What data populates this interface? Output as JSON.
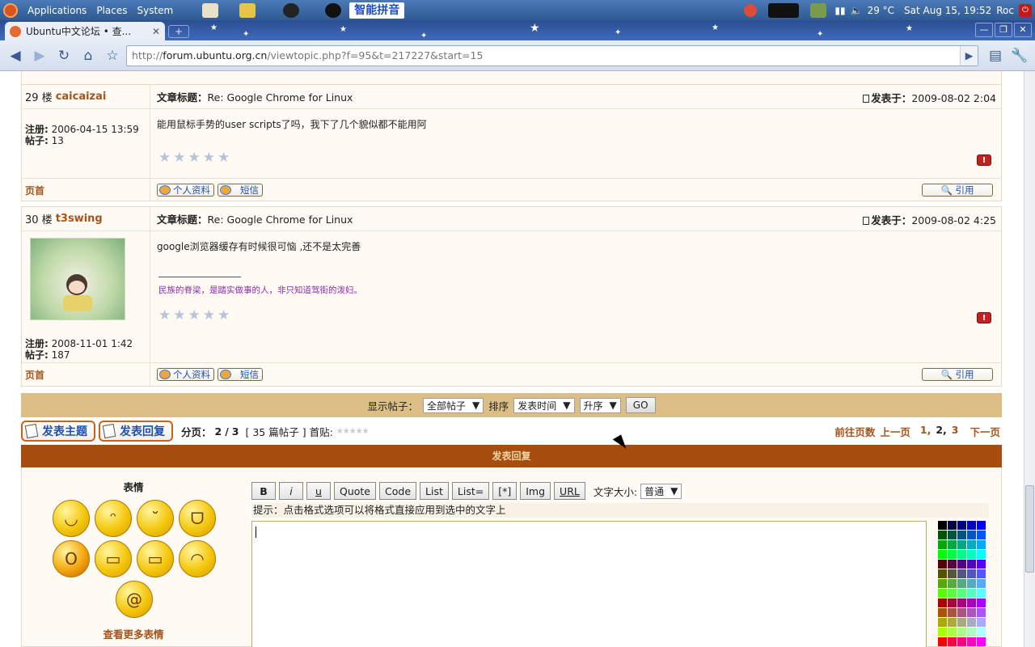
{
  "panel": {
    "menus": [
      "Applications",
      "Places",
      "System"
    ],
    "ime_label": "智能拼音",
    "weather": "29 °C",
    "clock": "Sat Aug 15, 19:52",
    "user": "Roc"
  },
  "browser": {
    "tab_title": "Ubuntu中文论坛 • 查...",
    "url_scheme": "http://",
    "url_host": "forum.ubuntu.org.cn",
    "url_path": "/viewtopic.php?f=95&t=217227&start=15"
  },
  "posts": [
    {
      "floor": "29 楼",
      "username": "caicaizai",
      "subject_label": "文章标题：",
      "subject": "Re: Google Chrome for Linux",
      "posted_label": "发表于：",
      "posted_at": "2009-08-02 2:04",
      "body": "能用鼠标手势的user scripts了吗，我下了几个貌似都不能用阿",
      "signature": "",
      "reg_label": "注册:",
      "reg_date": "2006-04-15 13:59",
      "posts_label": "帖子:",
      "post_count": "13",
      "top_label": "页首",
      "profile_btn": "个人资料",
      "pm_btn": "短信",
      "quote_btn": "引用"
    },
    {
      "floor": "30 楼",
      "username": "t3swing",
      "subject_label": "文章标题：",
      "subject": "Re: Google Chrome for Linux",
      "posted_label": "发表于：",
      "posted_at": "2009-08-02 4:25",
      "body": "google浏览器缓存有时候很可恼 ,还不是太完善",
      "signature": "民族的脊梁，是踏实做事的人，非只知道驾街的泼妇。",
      "reg_label": "注册:",
      "reg_date": "2008-11-01 1:42",
      "posts_label": "帖子:",
      "post_count": "187",
      "top_label": "页首",
      "profile_btn": "个人资料",
      "pm_btn": "短信",
      "quote_btn": "引用"
    }
  ],
  "filter": {
    "show_label": "显示帖子：",
    "show_value": "全部帖子",
    "sort_label": "排序",
    "sort_value": "发表时间",
    "order_value": "升序",
    "go_label": "GO"
  },
  "pager": {
    "new_topic": "发表主题",
    "reply": "发表回复",
    "page_label": "分页：",
    "page_current": "2",
    "page_total": "3",
    "count_text": "[ 35 篇帖子 ]",
    "first_post": "首贴:",
    "goto_label": "前往页数",
    "prev_label": "上一页",
    "pages": [
      "1",
      "2",
      "3"
    ],
    "next_label": "下一页"
  },
  "reply": {
    "header": "发表回复",
    "smilies_title": "表情",
    "more_smilies": "查看更多表情",
    "format_buttons": [
      "B",
      "i",
      "u",
      "Quote",
      "Code",
      "List",
      "List=",
      "[*]",
      "Img",
      "URL"
    ],
    "font_size_label": "文字大小:",
    "font_size_value": "普通",
    "hint": "提示：点击格式选项可以将格式直接应用到选中的文字上"
  }
}
